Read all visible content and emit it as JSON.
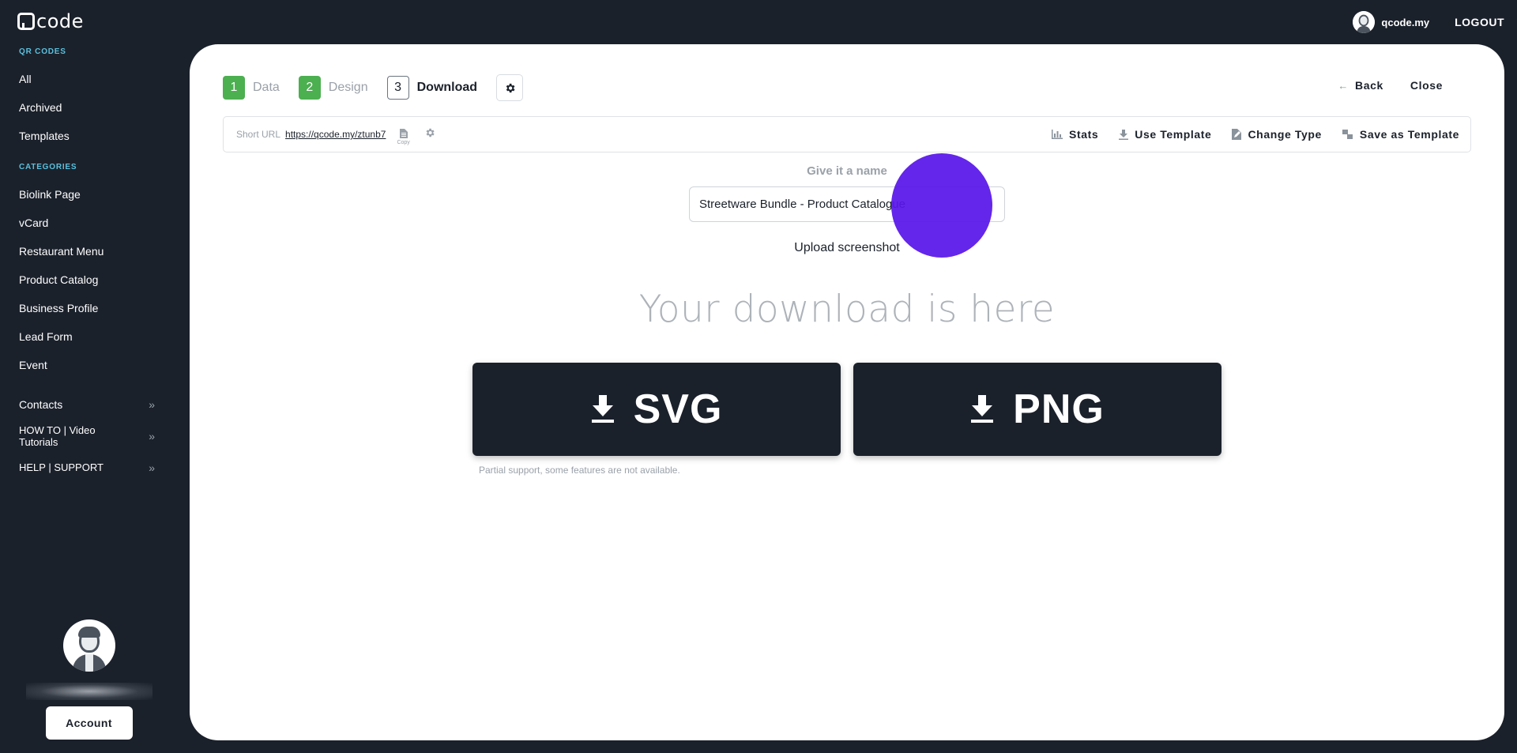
{
  "app": {
    "logo_text": "code",
    "user_name": "qcode.my",
    "logout_label": "LOGOUT"
  },
  "sidebar": {
    "section_qr": "QR CODES",
    "qr_items": [
      {
        "label": "All"
      },
      {
        "label": "Archived"
      },
      {
        "label": "Templates"
      }
    ],
    "section_categories": "CATEGORIES",
    "category_items": [
      {
        "label": "Biolink Page"
      },
      {
        "label": "vCard"
      },
      {
        "label": "Restaurant Menu"
      },
      {
        "label": "Product Catalog"
      },
      {
        "label": "Business Profile"
      },
      {
        "label": "Lead Form"
      },
      {
        "label": "Event"
      }
    ],
    "expand_items": [
      {
        "label": "Contacts"
      },
      {
        "label": "HOW TO | Video Tutorials"
      },
      {
        "label": "HELP | SUPPORT"
      }
    ],
    "account_label": "Account"
  },
  "steps": [
    {
      "number": "1",
      "label": "Data",
      "state": "done"
    },
    {
      "number": "2",
      "label": "Design",
      "state": "done"
    },
    {
      "number": "3",
      "label": "Download",
      "state": "active"
    }
  ],
  "nav": {
    "back_label": "Back",
    "close_label": "Close"
  },
  "toolbar": {
    "short_url_label": "Short URL",
    "short_url": "https://qcode.my/ztunb7",
    "copy_label": "Copy",
    "stats_label": "Stats",
    "use_template_label": "Use Template",
    "change_type_label": "Change Type",
    "save_template_label": "Save as Template"
  },
  "content": {
    "name_title": "Give it a name",
    "name_value": "Streetware Bundle - Product Catalogue",
    "upload_label": "Upload screenshot",
    "download_title": "Your download is here",
    "svg_label": "SVG",
    "png_label": "PNG",
    "partial_note": "Partial support, some features are not available."
  },
  "colors": {
    "sidebar_bg": "#1b212b",
    "accent_section": "#5bc0de",
    "step_done": "#4caf50",
    "cursor_highlight": "#5816e8"
  }
}
